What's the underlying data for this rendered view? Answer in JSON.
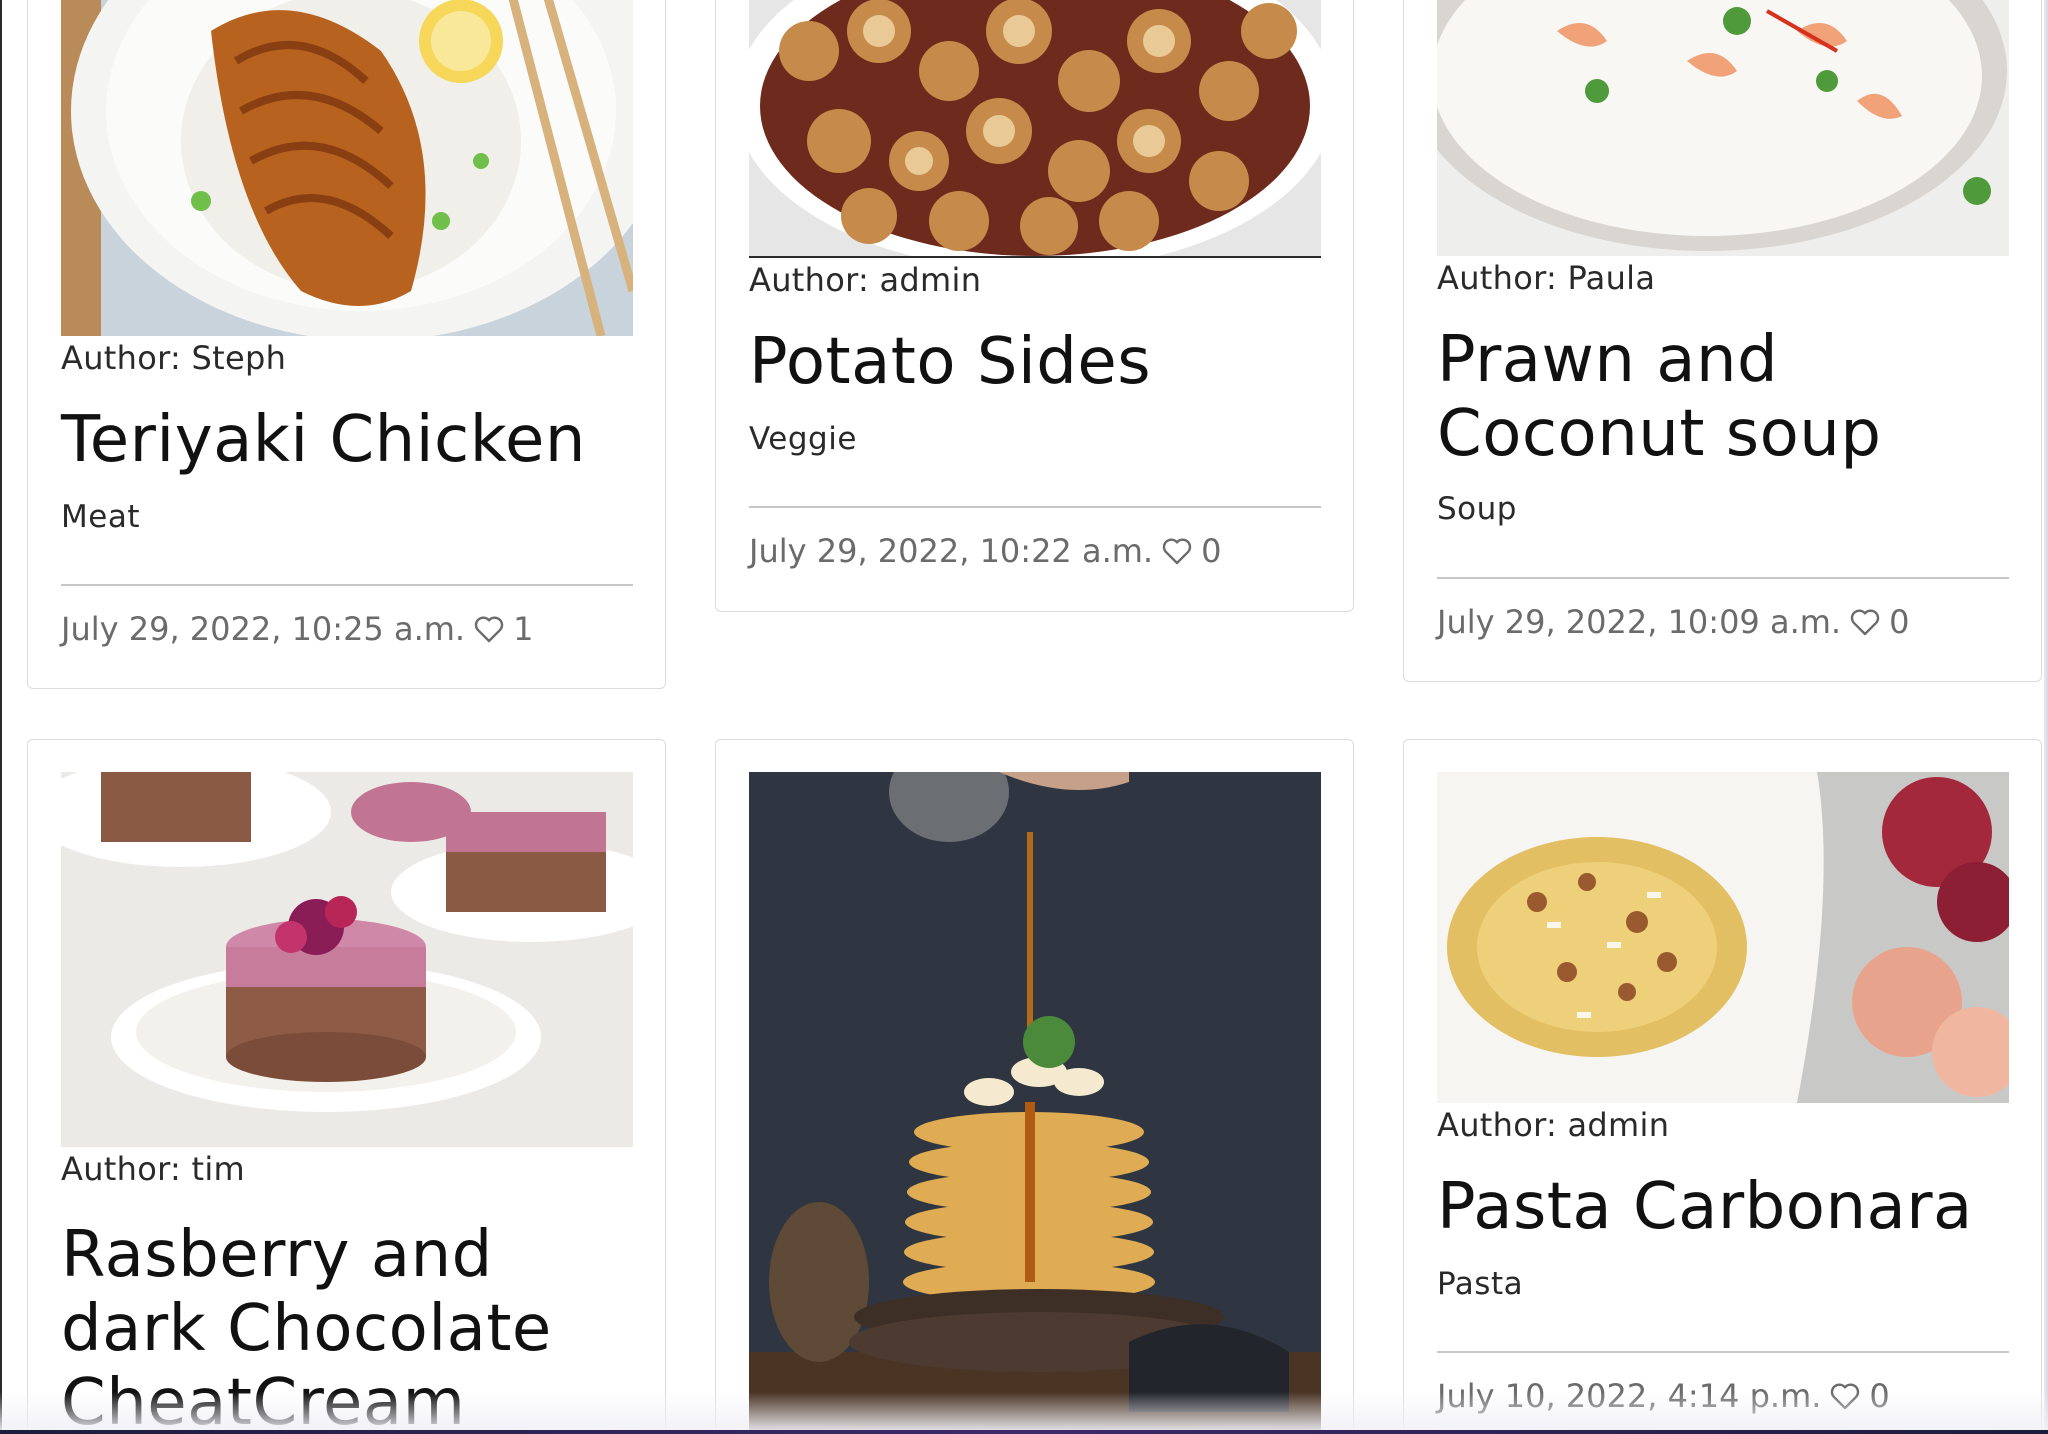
{
  "cards": [
    {
      "author": "Author: Steph",
      "title": "Teriyaki Chicken",
      "category": "Meat",
      "date": "July 29, 2022, 10:25 a.m.",
      "likes": "1"
    },
    {
      "author": "Author: admin",
      "title": "Potato Sides",
      "category": "Veggie",
      "date": "July 29, 2022, 10:22 a.m.",
      "likes": "0"
    },
    {
      "author": "Author: Paula",
      "title": "Prawn and Coconut soup",
      "category": "Soup",
      "date": "July 29, 2022, 10:09 a.m.",
      "likes": "0"
    },
    {
      "author": "Author: tim",
      "title": "Rasberry and dark Chocolate CheatCream",
      "category": "",
      "date": "",
      "likes": ""
    },
    {
      "author": "",
      "title": "",
      "category": "",
      "date": "",
      "likes": ""
    },
    {
      "author": "Author: admin",
      "title": "Pasta Carbonara",
      "category": "Pasta",
      "date": "July 10, 2022, 4:14 p.m.",
      "likes": "0"
    }
  ],
  "icons": {
    "like": "heart-outline-icon"
  },
  "colors": {
    "card_border": "#dcdcdc",
    "meta_text": "#6b6b6b",
    "title_text": "#111111"
  }
}
